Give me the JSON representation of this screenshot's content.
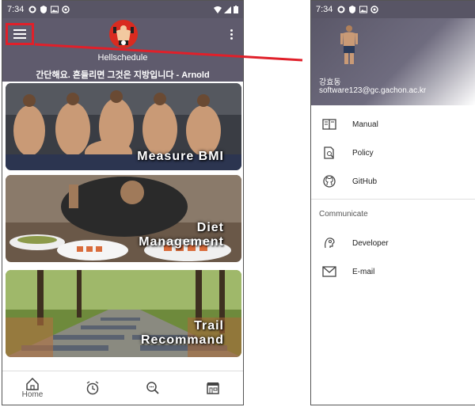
{
  "left_screen": {
    "status": {
      "time": "7:34"
    },
    "appbar": {
      "app_name": "Hellschedule",
      "quote": "간단해요. 흔들리면 그것은 지방입니다 - Arnold"
    },
    "cards": [
      {
        "label_lines": [
          "Measure BMI"
        ]
      },
      {
        "label_lines": [
          "Diet",
          "Management"
        ]
      },
      {
        "label_lines": [
          "Trail",
          "Recommand"
        ]
      }
    ],
    "bottom_nav": {
      "home_label": "Home",
      "icons": [
        "home-icon",
        "alarm-icon",
        "search-icon",
        "store-icon"
      ]
    }
  },
  "right_screen": {
    "status": {
      "time": "7:34"
    },
    "drawer": {
      "user_name": "강효동",
      "user_email": "software123@gc.gachon.ac.kr",
      "items": [
        {
          "label": "Manual",
          "icon": "book-icon"
        },
        {
          "label": "Policy",
          "icon": "policy-icon"
        },
        {
          "label": "GitHub",
          "icon": "github-icon"
        }
      ],
      "section_title": "Communicate",
      "comm_items": [
        {
          "label": "Developer",
          "icon": "developer-icon"
        },
        {
          "label": "E-mail",
          "icon": "mail-icon"
        }
      ]
    }
  },
  "colors": {
    "appbar": "#5f5b6d",
    "status_bar": "#585565",
    "highlight": "#e0202a"
  }
}
